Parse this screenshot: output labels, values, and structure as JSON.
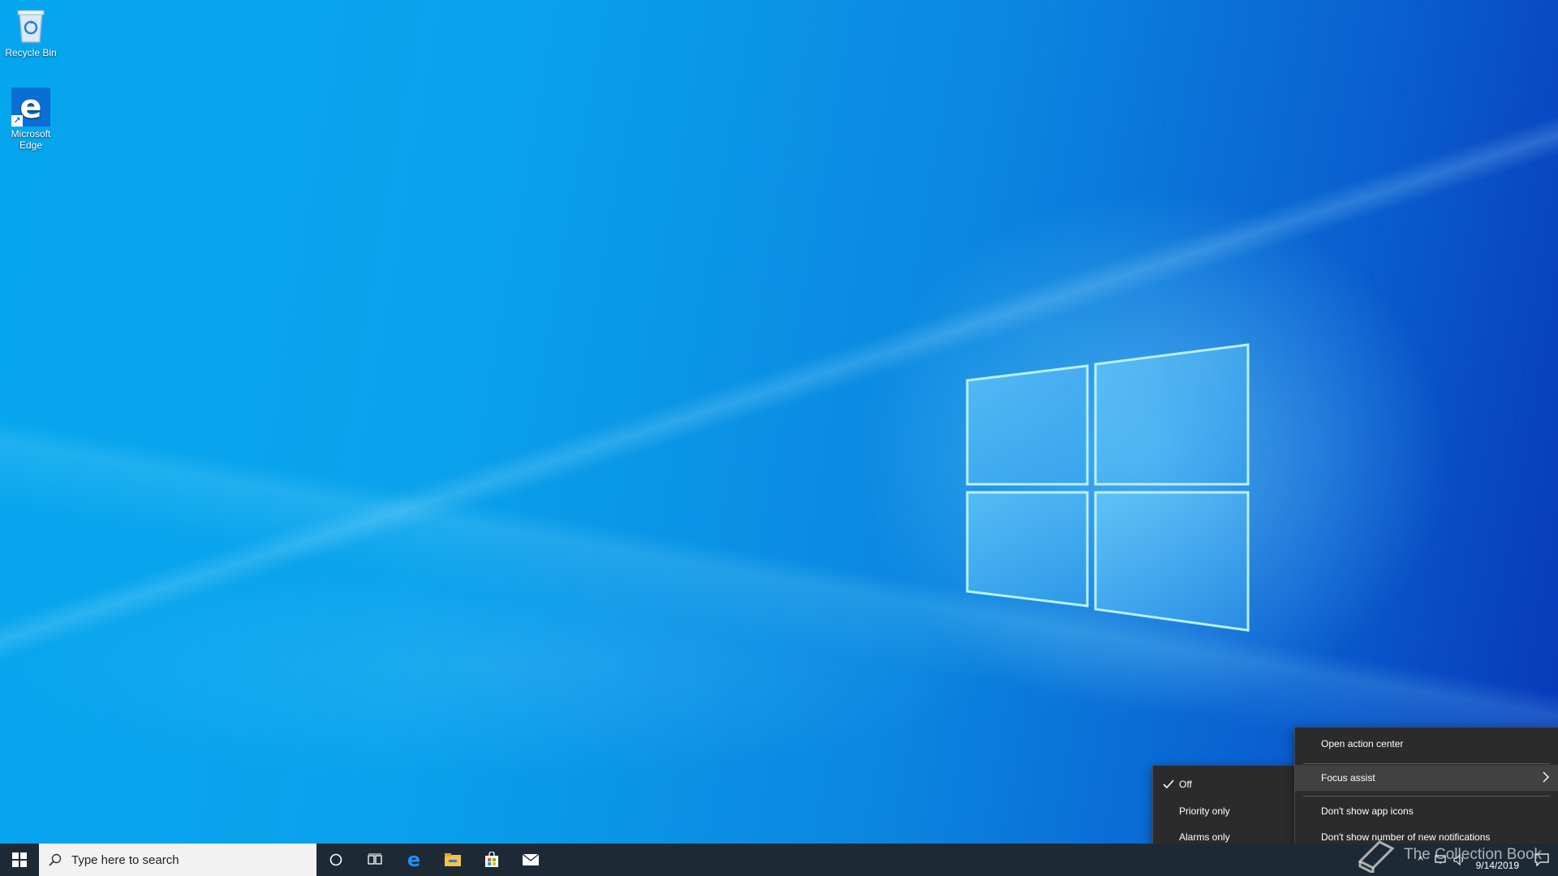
{
  "desktop": {
    "icons": [
      {
        "label": "Recycle Bin"
      },
      {
        "label": "Microsoft Edge"
      }
    ]
  },
  "taskbar": {
    "search_placeholder": "Type here to search",
    "apps": [
      "cortana-icon",
      "task-view-icon",
      "edge-icon",
      "file-explorer-icon",
      "store-icon",
      "mail-icon"
    ],
    "clock": {
      "date": "9/14/2019"
    }
  },
  "context_menu": {
    "items": [
      {
        "label": "Open action center"
      },
      {
        "label": "Focus assist",
        "has_submenu": true,
        "highlighted": true
      },
      {
        "label": "Don't show app icons"
      },
      {
        "label": "Don't show number of new notifications"
      }
    ]
  },
  "focus_assist_submenu": {
    "items": [
      {
        "label": "Off",
        "checked": true
      },
      {
        "label": "Priority only",
        "checked": false
      },
      {
        "label": "Alarms only",
        "checked": false
      }
    ]
  },
  "watermark": {
    "text": "The Collection Book"
  },
  "colors": {
    "taskbar": "#1d2a36",
    "menu_bg": "#2b2b2b",
    "menu_hover": "#414141",
    "desktop_accent": "#0aa2ec"
  }
}
